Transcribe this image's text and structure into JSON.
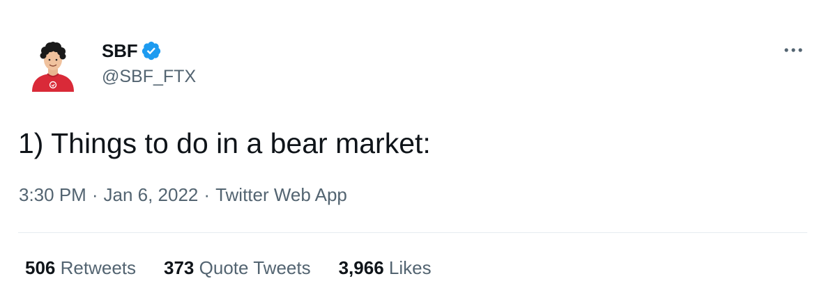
{
  "author": {
    "display_name": "SBF",
    "handle": "@SBF_FTX",
    "verified_icon": "verified-badge-icon",
    "verified_color": "#1d9bf0"
  },
  "more_icon": "more-horizontal-icon",
  "tweet": {
    "text": "1) Things to do in a bear market:"
  },
  "meta": {
    "time": "3:30 PM",
    "separator": "·",
    "date": "Jan 6, 2022",
    "source": "Twitter Web App"
  },
  "stats": [
    {
      "count": "506",
      "label": "Retweets"
    },
    {
      "count": "373",
      "label": "Quote Tweets"
    },
    {
      "count": "3,966",
      "label": "Likes"
    }
  ],
  "colors": {
    "text_primary": "#0f1419",
    "text_secondary": "#536471",
    "divider": "#e6ecf0",
    "avatar_shirt": "#d92a38"
  }
}
